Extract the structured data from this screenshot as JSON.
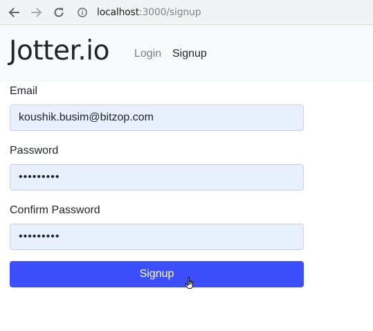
{
  "browser": {
    "url_host": "localhost",
    "url_rest": ":3000/signup"
  },
  "navbar": {
    "brand": "Jotter.io",
    "links": {
      "login": "Login",
      "signup": "Signup"
    }
  },
  "form": {
    "email_label": "Email",
    "email_value": "koushik.busim@bitzop.com",
    "password_label": "Password",
    "password_value": "•••••••••",
    "confirm_label": "Confirm Password",
    "confirm_value": "•••••••••",
    "submit_label": "Signup"
  },
  "icons": {
    "back": "back-arrow-icon",
    "forward": "forward-arrow-icon",
    "reload": "reload-icon",
    "info": "info-icon",
    "cursor": "hand-pointer-icon"
  },
  "colors": {
    "navbar_bg": "#f8f9fa",
    "input_bg": "#e8f0fe",
    "button_bg": "#3d4ffb",
    "brand_text": "#212529",
    "muted_link": "#7a7f84"
  }
}
